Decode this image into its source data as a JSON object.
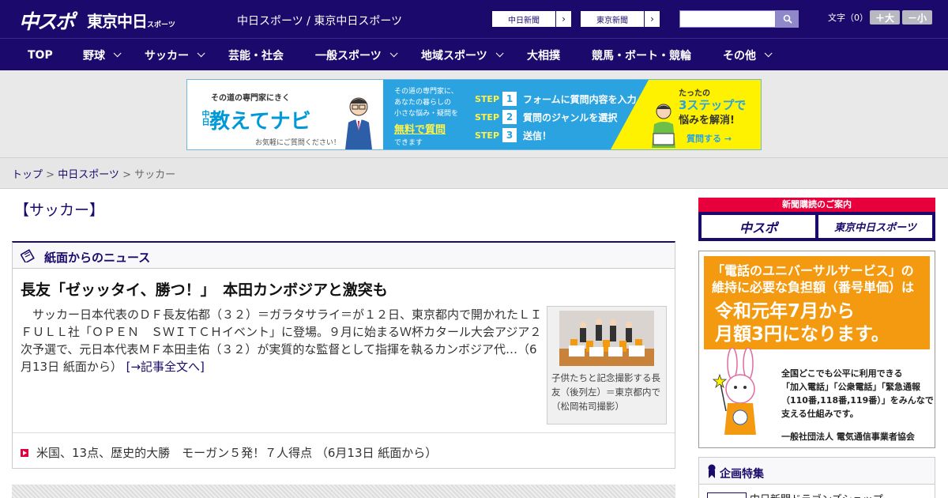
{
  "header": {
    "logo_main": "中スポ",
    "logo_tokyo": "東京中日",
    "logo_tokyo_small": "スポーツ",
    "site_links": "中日スポーツ / 東京中日スポーツ",
    "paper_buttons": [
      "中日新聞",
      "東京新聞"
    ],
    "fontsize_label": "文字（0）",
    "fontsize_large": "＋大",
    "fontsize_small": "－小"
  },
  "nav": {
    "items": [
      {
        "label": "TOP"
      },
      {
        "label": "野球"
      },
      {
        "label": "サッカー"
      },
      {
        "label": "芸能・社会"
      },
      {
        "label": "一般スポーツ"
      },
      {
        "label": "地域スポーツ"
      },
      {
        "label": "大相撲"
      },
      {
        "label": "競馬・ボート・競輪"
      },
      {
        "label": "その他"
      }
    ]
  },
  "ad": {
    "tagline": "その道の専門家にきく",
    "brand_small": "中日",
    "brand": "教えてナビ",
    "caption": "お気軽にご質問ください！",
    "desc_lines": [
      "その道の専門家に、",
      "あなたの暮らしの",
      "小さな悩み・疑問を"
    ],
    "free": "無料で質問",
    "can": "できます",
    "steps": [
      {
        "label": "STEP",
        "num": "1",
        "text": "フォームに質問内容を入力"
      },
      {
        "label": "STEP",
        "num": "2",
        "text": "質問のジャンルを選択"
      },
      {
        "label": "STEP",
        "num": "3",
        "text": "送信！"
      }
    ],
    "right_t1": "たったの",
    "right_t2": "3ステップで",
    "right_t3": "悩みを解消!",
    "right_cta": "質問する →"
  },
  "breadcrumb": {
    "items": [
      "トップ",
      "中日スポーツ"
    ],
    "current": "サッカー",
    "sep": " > "
  },
  "page": {
    "title": "【サッカー】"
  },
  "news": {
    "section_title": "紙面からのニュース",
    "headline": "長友「ゼッッタイ、勝つ！」　本田カンボジアと激突も",
    "body": "　サッカー日本代表のＤＦ長友佑都（３２）＝ガラタサライ＝が１２日、東京都内で開かれたＬＩＦＵＬＬ社「ＯＰＥＮ　ＳＷＩＴＣＨイベント」に登場。９月に始まるＷ杯カタール大会アジア２次予選で、元日本代表ＭＦ本田圭佑（３２）が実質的な監督として指揮を執るカンボジア代…（6月13日 紙面から）",
    "more": "[→記事全文へ]",
    "photo_caption": "子供たちと記念撮影する長友（後列左）＝東京都内で（松岡祐司撮影）",
    "sub_item": "米国、13点、歴史的大勝　モーガン５発！７人得点 （6月13日 紙面から）"
  },
  "sidebar": {
    "sub_title": "新聞購読のご案内",
    "sub_buttons": [
      "中スポ",
      "東京中日スポーツ"
    ],
    "usf_line1": "「電話のユニバーサルサービス」の維持に必要な負担額（番号単価）は",
    "usf_line2a": "令和元年7月から",
    "usf_line2b": "月額3円になります。",
    "usf_info": [
      "全国どこでも公平に利用できる",
      "「加入電話」「公衆電話」「緊急通報",
      "（110番,118番,119番）」をみんなで",
      "支える仕組みです。"
    ],
    "usf_org": "一般社団法人 電気通信事業者協会",
    "feature_title": "企画特集",
    "feature_item": "中日新聞ドラゴンズショップ"
  },
  "colors": {
    "brand_navy": "#1b0a6b",
    "accent_red": "#e0003c",
    "ad_blue": "#2aa3e0",
    "ad_yellow": "#fff200",
    "usf_orange": "#f39a10"
  }
}
